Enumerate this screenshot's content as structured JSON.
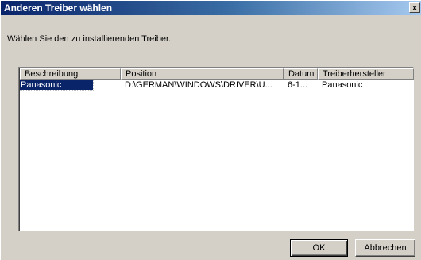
{
  "window": {
    "title": "Anderen Treiber wählen",
    "close_label": "x"
  },
  "instruction": "Wählen Sie den zu installierenden Treiber.",
  "table": {
    "columns": [
      "Beschreibung",
      "Position",
      "Datum",
      "Treiberhersteller"
    ],
    "rows": [
      {
        "beschreibung": "Panasonic",
        "position": "D:\\GERMAN\\WINDOWS\\DRIVER\\U...",
        "datum": "6-1...",
        "hersteller": "Panasonic",
        "selected": true
      }
    ]
  },
  "buttons": {
    "ok": "OK",
    "cancel": "Abbrechen"
  }
}
